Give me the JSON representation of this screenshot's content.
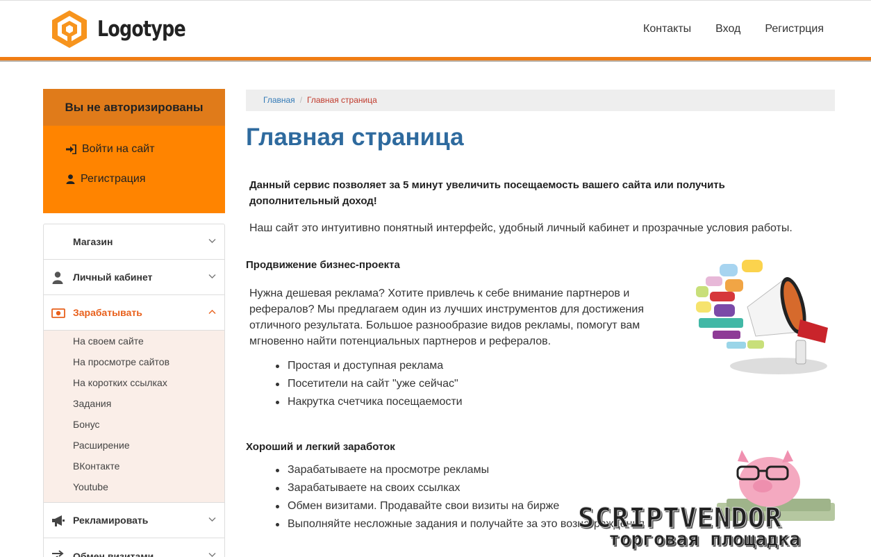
{
  "header": {
    "logo_text": "Logotype",
    "nav": [
      "Контакты",
      "Вход",
      "Регистрция"
    ],
    "accent_color": "#f07d14"
  },
  "sidebar": {
    "auth_title": "Вы не авторизированы",
    "login_label": "Войти на сайт",
    "register_label": "Регистрация",
    "menu": [
      {
        "label": "Магазин",
        "icon": "none",
        "expanded": false
      },
      {
        "label": "Личный кабинет",
        "icon": "user-icon",
        "expanded": false
      },
      {
        "label": "Зарабатывать",
        "icon": "money-icon",
        "expanded": true
      },
      {
        "label": "Рекламировать",
        "icon": "megaphone-icon",
        "expanded": false
      },
      {
        "label": "Обмен визитами",
        "icon": "exchange-icon",
        "expanded": false
      }
    ],
    "submenu": [
      "На своем сайте",
      "На просмотре сайтов",
      "На коротких ссылках",
      "Задания",
      "Бонус",
      "Расширение",
      "ВКонтакте",
      "Youtube"
    ]
  },
  "breadcrumb": {
    "home": "Главная",
    "separator": "/",
    "current": "Главная страница"
  },
  "main": {
    "title": "Главная страница",
    "lead": "Данный сервис позволяет за 5 минут увеличить посещаемость вашего сайта или получить дополнительный доход!",
    "intro": "Наш сайт это интуитивно понятный интерфейс, удобный личный кабинет и прозрачные условия работы.",
    "section1": {
      "title": "Продвижение бизнес-проекта",
      "text": "Нужна дешевая реклама? Хотите привлечь к себе внимание партнеров и рефералов? Мы предлагаем один из лучших инструментов для достижения отличного результата. Большое разнообразие видов рекламы, помогут вам мгновенно найти потенциальных партнеров и рефералов.",
      "bullets": [
        "Простая и доступная реклама",
        "Посетители на сайт \"уже сейчас\"",
        "Накрутка счетчика посещаемости"
      ]
    },
    "section2": {
      "title": "Хороший и легкий заработок",
      "bullets": [
        "Зарабатываете на просмотре рекламы",
        "Зарабатываете на своих ссылках",
        "Обмен визитами. Продавайте свои визиты на бирже",
        "Выполняйте несложные задания и получайте за это вознаграждения"
      ]
    }
  },
  "watermark": {
    "line1": "SCRIPTVENDOR",
    "line2": "торговая площадка"
  }
}
